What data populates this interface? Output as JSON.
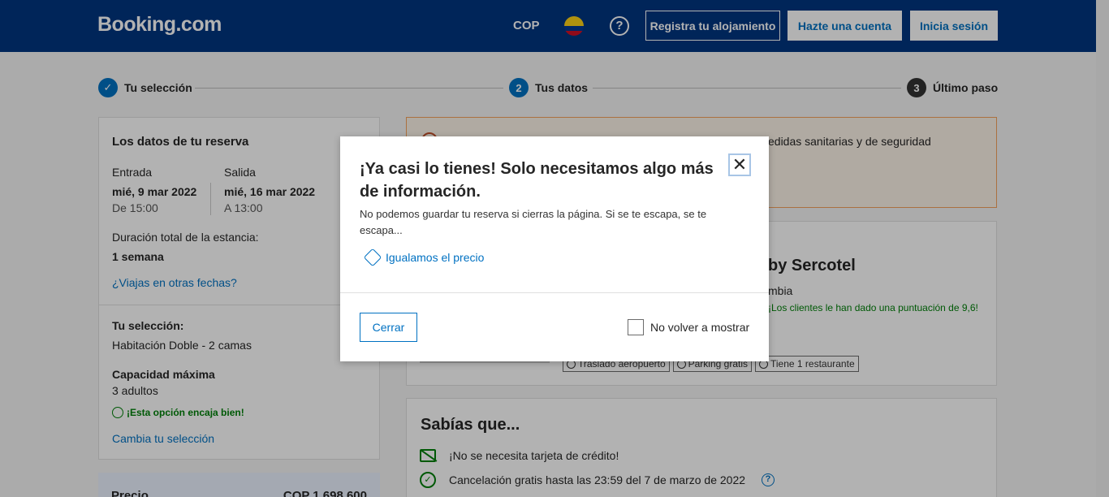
{
  "header": {
    "logo": "Booking.com",
    "currency": "COP",
    "help": "?",
    "register_property": "Registra tu alojamiento",
    "create_account": "Hazte una cuenta",
    "sign_in": "Inicia sesión"
  },
  "stepper": [
    {
      "number": "✓",
      "label": "Tu selección"
    },
    {
      "number": "2",
      "label": "Tus datos"
    },
    {
      "number": "3",
      "label": "Último paso"
    }
  ],
  "booking": {
    "title": "Los datos de tu reserva",
    "checkin_label": "Entrada",
    "checkin_date": "mié, 9 mar 2022",
    "checkin_time": "De 15:00",
    "checkout_label": "Salida",
    "checkout_date": "mié, 16 mar 2022",
    "checkout_time": "A 13:00",
    "duration_label": "Duración total de la estancia:",
    "duration_value": "1 semana",
    "other_dates_link": "¿Viajas en otras fechas?",
    "selection_label": "Tu selección:",
    "selection_value": "Habitación Doble - 2 camas",
    "capacity_label": "Capacidad máxima",
    "capacity_value": "3 adultos",
    "fit_note": "¡Esta opción encaja bien!",
    "change_selection_link": "Cambia tu selección",
    "price_label": "Precio",
    "price_value": "COP 1.698.600"
  },
  "alert": {
    "text": "edidas sanitarias y de seguridad"
  },
  "hotel": {
    "name": "by Sercotel",
    "location": "mbia",
    "review": "¡Los clientes le han dado una puntuación de 9,6!",
    "tags": [
      "Traslado aeropuerto",
      "Parking gratis",
      "Tiene 1 restaurante"
    ]
  },
  "know": {
    "title": "Sabías que...",
    "items": [
      "¡No se necesita tarjeta de crédito!",
      "Cancelación gratis hasta las 23:59 del 7 de marzo de 2022"
    ]
  },
  "modal": {
    "title": "¡Ya casi lo tienes! Solo necesitamos algo más de información.",
    "text": "No podemos guardar tu reserva si cierras la página. Si se te escapa, se te escapa...",
    "link": "Igualamos el precio",
    "close_button": "Cerrar",
    "dont_show_label": "No volver a mostrar"
  }
}
